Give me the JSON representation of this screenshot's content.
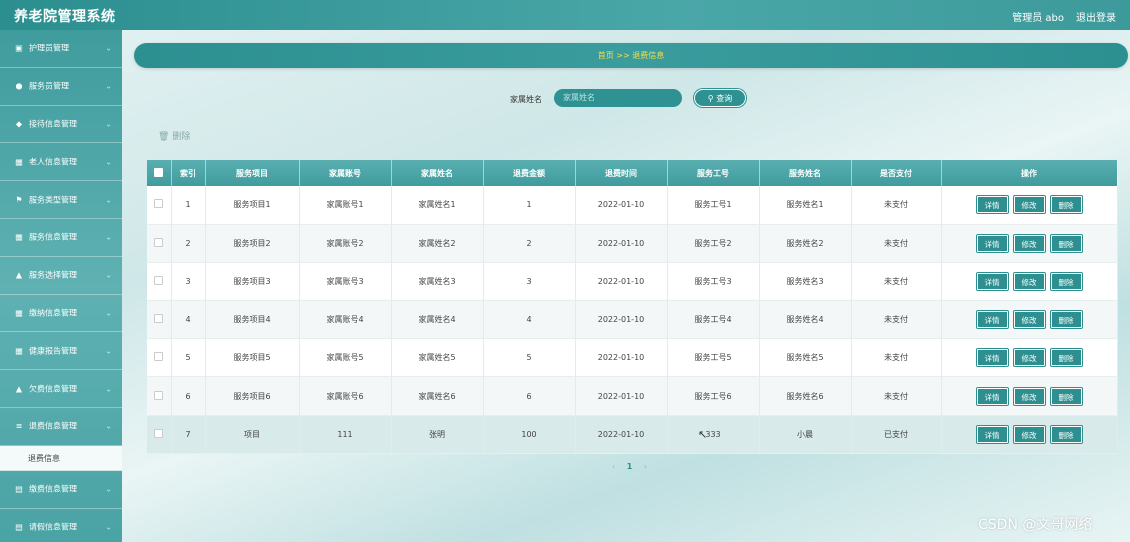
{
  "header": {
    "title": "养老院管理系统",
    "user": "管理员 abo",
    "logout": "退出登录"
  },
  "sidebar": {
    "items": [
      {
        "icon": "▣",
        "label": "护理员管理"
      },
      {
        "icon": "●",
        "label": "服务员管理"
      },
      {
        "icon": "◆",
        "label": "接待信息管理"
      },
      {
        "icon": "▦",
        "label": "老人信息管理"
      },
      {
        "icon": "⚑",
        "label": "服务类型管理"
      },
      {
        "icon": "▦",
        "label": "服务信息管理"
      },
      {
        "icon": "▲",
        "label": "服务选择管理"
      },
      {
        "icon": "▦",
        "label": "缴纳信息管理"
      },
      {
        "icon": "▦",
        "label": "健康报告管理"
      },
      {
        "icon": "▲",
        "label": "欠费信息管理"
      },
      {
        "icon": "≡",
        "label": "退费信息管理"
      }
    ],
    "sub_item": "退费信息",
    "items_after": [
      {
        "icon": "▤",
        "label": "缴费信息管理"
      },
      {
        "icon": "▤",
        "label": "请假信息管理"
      }
    ]
  },
  "breadcrumb": "首页 >> 退费信息",
  "search": {
    "label": "家属姓名",
    "placeholder": "家属姓名",
    "button": "查询",
    "button_icon": "search-icon"
  },
  "delete_all": "删除",
  "table": {
    "headers": [
      "索引",
      "服务项目",
      "家属账号",
      "家属姓名",
      "退费金额",
      "退费时间",
      "服务工号",
      "服务姓名",
      "是否支付",
      "操作"
    ],
    "actions": [
      "详情",
      "修改",
      "删除"
    ],
    "rows": [
      [
        "1",
        "服务项目1",
        "家属账号1",
        "家属姓名1",
        "1",
        "2022-01-10",
        "服务工号1",
        "服务姓名1",
        "未支付"
      ],
      [
        "2",
        "服务项目2",
        "家属账号2",
        "家属姓名2",
        "2",
        "2022-01-10",
        "服务工号2",
        "服务姓名2",
        "未支付"
      ],
      [
        "3",
        "服务项目3",
        "家属账号3",
        "家属姓名3",
        "3",
        "2022-01-10",
        "服务工号3",
        "服务姓名3",
        "未支付"
      ],
      [
        "4",
        "服务项目4",
        "家属账号4",
        "家属姓名4",
        "4",
        "2022-01-10",
        "服务工号4",
        "服务姓名4",
        "未支付"
      ],
      [
        "5",
        "服务项目5",
        "家属账号5",
        "家属姓名5",
        "5",
        "2022-01-10",
        "服务工号5",
        "服务姓名5",
        "未支付"
      ],
      [
        "6",
        "服务项目6",
        "家属账号6",
        "家属姓名6",
        "6",
        "2022-01-10",
        "服务工号6",
        "服务姓名6",
        "未支付"
      ],
      [
        "7",
        "项目",
        "111",
        "张明",
        "100",
        "2022-01-10",
        "333",
        "小晨",
        "已支付"
      ]
    ]
  },
  "pager": {
    "prev": "‹",
    "current": "1",
    "next": "›"
  },
  "watermark": "CSDN @文哥网络"
}
